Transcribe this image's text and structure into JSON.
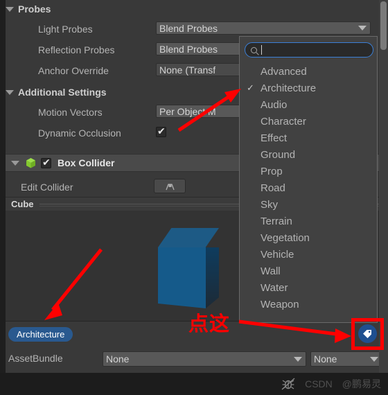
{
  "window": {
    "background": "#393939",
    "accent": "#3b80d8",
    "tag_color": "#29598f"
  },
  "inspector": {
    "sections": [
      {
        "title": "Probes",
        "foldout": "expanded"
      },
      {
        "title": "Additional Settings",
        "foldout": "expanded"
      }
    ],
    "probes_rows": [
      {
        "label": "Light Probes",
        "value": "Blend Probes",
        "type": "dropdown"
      },
      {
        "label": "Reflection Probes",
        "value": "Blend Probes",
        "type": "dropdown"
      },
      {
        "label": "Anchor Override",
        "value": "None (Transf",
        "type": "object-field"
      }
    ],
    "additional_rows": [
      {
        "label": "Motion Vectors",
        "value": "Per Object M",
        "type": "dropdown"
      },
      {
        "label": "Dynamic Occlusion",
        "value": "checked",
        "type": "checkbox"
      }
    ],
    "component": {
      "name": "Box Collider",
      "enabled": true,
      "foldout": "expanded",
      "icon": "box-collider-icon",
      "edit_collider_label": "Edit Collider",
      "edit_collider_button_icon": "edit-collider-icon"
    },
    "preview": {
      "name": "Cube",
      "object": "blue-cube-3d"
    },
    "tag_pill": {
      "label": "Architecture"
    },
    "assetbundle": {
      "label": "AssetBundle",
      "name_value": "None",
      "variant_value": "None"
    },
    "tag_button": {
      "icon": "tag-icon"
    }
  },
  "dropdown": {
    "search": {
      "value": "",
      "placeholder": "",
      "icon": "search-icon"
    },
    "selected": "Architecture",
    "options": [
      "Advanced",
      "Architecture",
      "Audio",
      "Character",
      "Effect",
      "Ground",
      "Prop",
      "Road",
      "Sky",
      "Terrain",
      "Vegetation",
      "Vehicle",
      "Wall",
      "Water",
      "Weapon"
    ]
  },
  "annotations": {
    "click_here_text": "点这",
    "arrow_color": "#ff0000",
    "highlight_color": "#ff0000"
  },
  "statusbar": {
    "icons": [
      "bug-icon"
    ],
    "watermarks": [
      "CSDN",
      "@鹏易灵"
    ]
  }
}
